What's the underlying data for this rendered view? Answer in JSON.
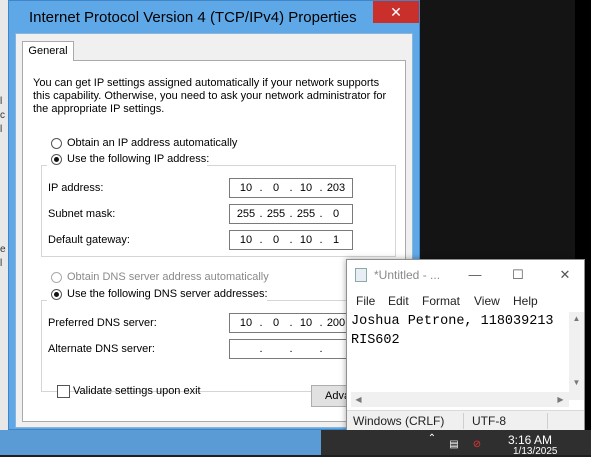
{
  "dialog": {
    "title": "Internet Protocol Version 4 (TCP/IPv4) Properties",
    "close_glyph": "✕",
    "tab": "General",
    "description": "You can get IP settings assigned automatically if your network supports this capability. Otherwise, you need to ask your network administrator for the appropriate IP settings.",
    "ip_auto_label": "Obtain an IP address automatically",
    "ip_manual_label": "Use the following IP address:",
    "ip_address_label": "IP address:",
    "ip_address": [
      "10",
      "0",
      "10",
      "203"
    ],
    "subnet_label": "Subnet mask:",
    "subnet": [
      "255",
      "255",
      "255",
      "0"
    ],
    "gateway_label": "Default gateway:",
    "gateway": [
      "10",
      "0",
      "10",
      "1"
    ],
    "dns_auto_label": "Obtain DNS server address automatically",
    "dns_manual_label": "Use the following DNS server addresses:",
    "preferred_dns_label": "Preferred DNS server:",
    "preferred_dns": [
      "10",
      "0",
      "10",
      "200"
    ],
    "alternate_dns_label": "Alternate DNS server:",
    "alternate_dns": [
      "",
      "",
      "",
      ""
    ],
    "validate_label": "Validate settings upon exit",
    "advanced_label": "Advanced..."
  },
  "notepad": {
    "title": "*Untitled - ...",
    "min_glyph": "—",
    "max_glyph": "☐",
    "close_glyph": "✕",
    "menu": [
      "File",
      "Edit",
      "Format",
      "View",
      "Help"
    ],
    "lines": [
      "Joshua Petrone, 118039213",
      "RIS602"
    ],
    "status_eol": "Windows (CRLF)",
    "status_encoding": "UTF-8"
  },
  "taskbar": {
    "time": "3:16 AM",
    "date": "1/13/2025"
  },
  "colors": {
    "dialog_frame": "#5fa8e8",
    "close_button": "#c9302c",
    "taskbar": "#2c68a6"
  }
}
